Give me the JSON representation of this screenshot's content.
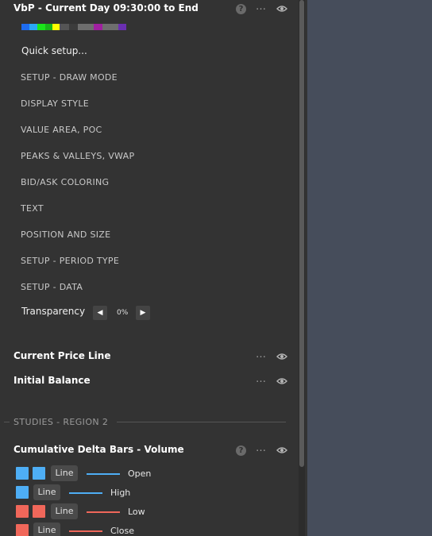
{
  "study": {
    "title": "VbP - Current Day 09:30:00 to End",
    "help_glyph": "?",
    "more_glyph": "…",
    "palette_colors": [
      "#1e6cf0",
      "#2aa8f5",
      "#1ae61a",
      "#1ab51a",
      "#ffff00",
      "#555555",
      "#3c3c3c",
      "#6e6e6e",
      "#6e6e6e",
      "#a020a0",
      "#6e6e6e",
      "#6e6e6e",
      "#6a2fb0"
    ],
    "quick_setup": "Quick setup...",
    "menu_items": [
      "SETUP - DRAW MODE",
      "DISPLAY STYLE",
      "VALUE AREA, POC",
      "PEAKS & VALLEYS, VWAP",
      "BID/ASK COLORING",
      "TEXT",
      "POSITION AND SIZE",
      "SETUP - PERIOD TYPE",
      "SETUP - DATA"
    ],
    "transparency_label": "Transparency",
    "transparency_value": "0%",
    "left_arrow": "◀",
    "right_arrow": "▶"
  },
  "indicators": [
    {
      "name": "Current Price Line"
    },
    {
      "name": "Initial Balance"
    }
  ],
  "section": {
    "label": "STUDIES - REGION 2"
  },
  "cdb": {
    "title": "Cumulative Delta Bars - Volume",
    "plots": [
      {
        "label": "Open",
        "color": "#4eaef5",
        "double": true,
        "line_text": "Line"
      },
      {
        "label": "High",
        "color": "#4eaef5",
        "double": false,
        "line_text": "Line"
      },
      {
        "label": "Low",
        "color": "#f0675a",
        "double": true,
        "line_text": "Line"
      },
      {
        "label": "Close",
        "color": "#f0675a",
        "double": false,
        "line_text": "Line"
      }
    ]
  }
}
